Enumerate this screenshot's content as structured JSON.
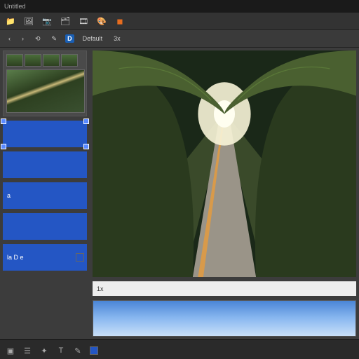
{
  "titlebar": {
    "title": "Untitled"
  },
  "taskbar": {
    "icons": [
      "folder-icon",
      "image-icon",
      "camera-icon",
      "layers-icon",
      "film-icon",
      "palette-icon",
      "app-icon"
    ]
  },
  "toolbar": {
    "back": "‹",
    "forward": "›",
    "logo": "D",
    "label1": "Default",
    "label2": "3x"
  },
  "left": {
    "panels": [
      {
        "label": ""
      },
      {
        "label": ""
      },
      {
        "label": "a"
      },
      {
        "label": ""
      },
      {
        "label": "la  D e"
      }
    ]
  },
  "canvas": {
    "statuslabel": "1x"
  },
  "bottombar": {
    "icons": [
      "crop-icon",
      "layers-icon",
      "fx-icon",
      "text-icon",
      "brush-icon"
    ]
  }
}
